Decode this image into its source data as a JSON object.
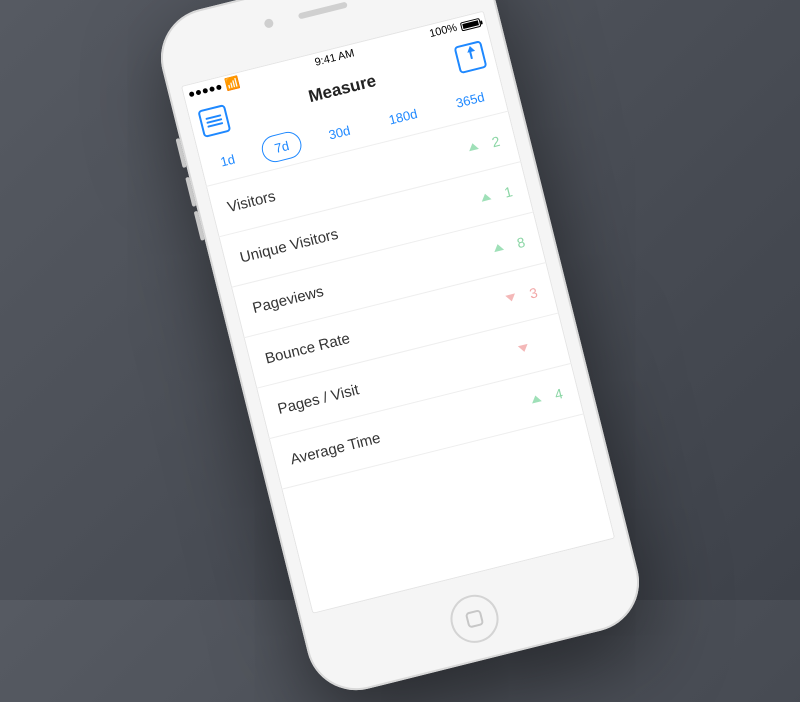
{
  "statusbar": {
    "time": "9:41 AM",
    "battery_pct": "100%"
  },
  "navbar": {
    "title": "Measure"
  },
  "ranges": {
    "items": [
      "1d",
      "7d",
      "30d",
      "180d",
      "365d"
    ],
    "active_index": 1
  },
  "metrics": [
    {
      "label": "Visitors",
      "trend": "up",
      "value": "2"
    },
    {
      "label": "Unique Visitors",
      "trend": "up",
      "value": "1"
    },
    {
      "label": "Pageviews",
      "trend": "up",
      "value": "8"
    },
    {
      "label": "Bounce Rate",
      "trend": "down",
      "value": "3"
    },
    {
      "label": "Pages / Visit",
      "trend": "down",
      "value": ""
    },
    {
      "label": "Average Time",
      "trend": "up",
      "value": "4"
    }
  ]
}
